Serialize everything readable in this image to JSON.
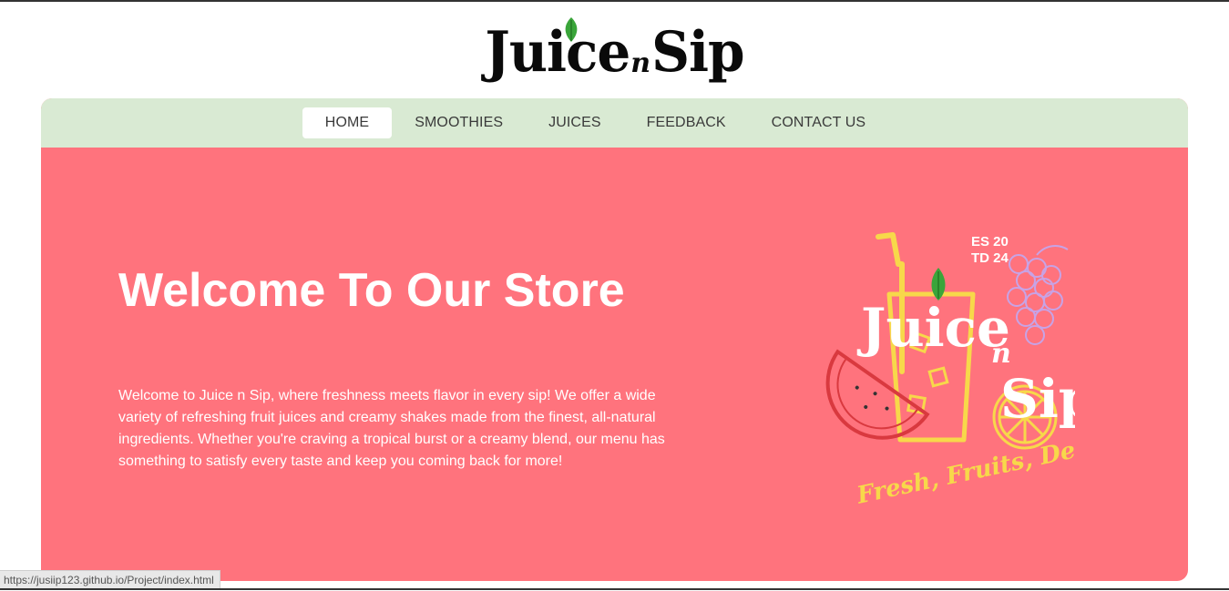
{
  "header": {
    "logo_word1": "Juice",
    "logo_n": "n",
    "logo_word2": "Sip"
  },
  "nav": {
    "items": [
      {
        "label": "HOME",
        "active": true
      },
      {
        "label": "SMOOTHIES",
        "active": false
      },
      {
        "label": "JUICES",
        "active": false
      },
      {
        "label": "FEEDBACK",
        "active": false
      },
      {
        "label": "CONTACT US",
        "active": false
      }
    ]
  },
  "hero": {
    "title": "Welcome To Our Store",
    "paragraph": "Welcome to Juice n Sip, where freshness meets flavor in every sip! We offer a wide variety of refreshing fruit juices and creamy shakes made from the finest, all-natural ingredients. Whether you're craving a tropical burst or a creamy blend, our menu has something to satisfy every taste and keep you coming back for more!",
    "logo_established_line1": "ES 20",
    "logo_established_line2": "TD 24",
    "logo_word1": "Juice",
    "logo_n": "n",
    "logo_word2": "Sip",
    "logo_tagline": "Fresh, Fruits, Delicious"
  },
  "status_bar": {
    "url": "https://jusiip123.github.io/Project/index.html"
  },
  "colors": {
    "hero_bg": "#ff737d",
    "nav_bg": "#d9ead3",
    "leaf_green": "#3aa53a",
    "tagline_yellow": "#f7d84a"
  }
}
